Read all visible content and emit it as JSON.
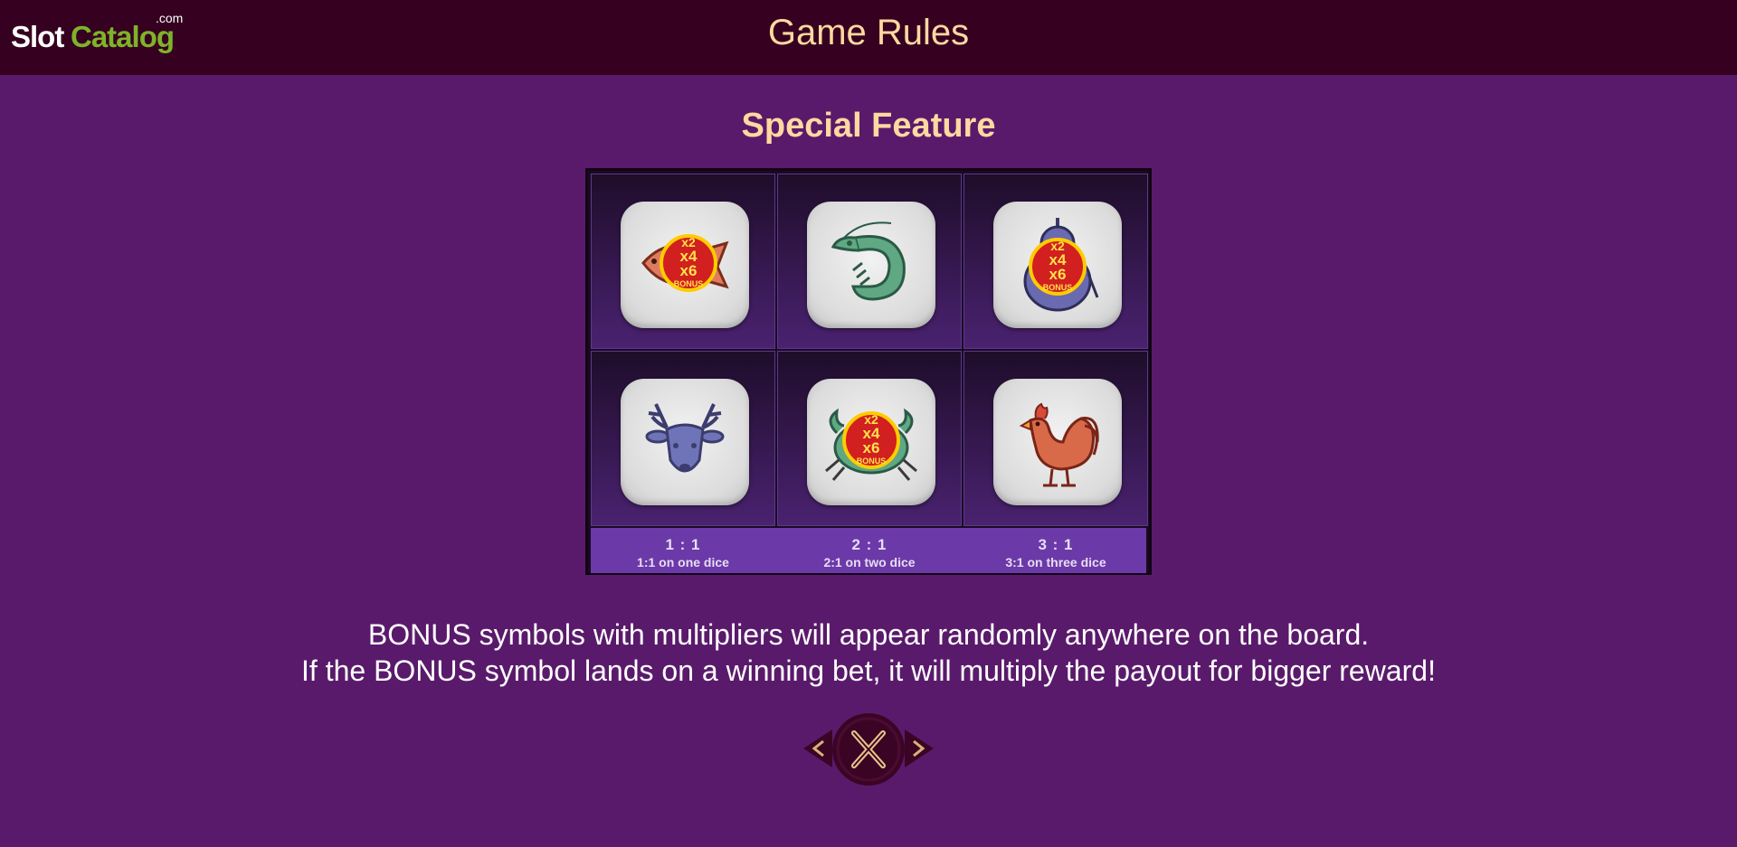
{
  "logo": {
    "part1": "Slot",
    "part2": "Catalog",
    "suffix": ".com"
  },
  "header": {
    "title": "Game Rules"
  },
  "section": {
    "title": "Special Feature"
  },
  "dice": [
    {
      "icon": "fish-bonus-icon",
      "bonus": [
        "x2",
        "x4",
        "x6",
        "BONUS"
      ]
    },
    {
      "icon": "shrimp-icon"
    },
    {
      "icon": "gourd-bonus-icon",
      "bonus": [
        "x2",
        "x4",
        "x6",
        "BONUS"
      ]
    },
    {
      "icon": "deer-icon"
    },
    {
      "icon": "crab-bonus-icon",
      "bonus": [
        "x2",
        "x4",
        "x6",
        "BONUS"
      ]
    },
    {
      "icon": "rooster-icon"
    }
  ],
  "payouts": [
    {
      "ratio": "1 : 1",
      "desc": "1:1 on one dice"
    },
    {
      "ratio": "2 : 1",
      "desc": "2:1 on two dice"
    },
    {
      "ratio": "3 : 1",
      "desc": "3:1 on three dice"
    }
  ],
  "description": {
    "line1": "BONUS symbols with multipliers will appear randomly anywhere on the board.",
    "line2": "If the BONUS symbol lands on a winning bet, it will multiply the payout for bigger reward!"
  },
  "nav": {
    "prev_icon": "chevron-left-icon",
    "close_icon": "close-icon",
    "next_icon": "chevron-right-icon"
  },
  "colors": {
    "background": "#5a1a6b",
    "header": "#360020",
    "title": "#ffd9a0",
    "payrow": "#6b3aa8"
  }
}
